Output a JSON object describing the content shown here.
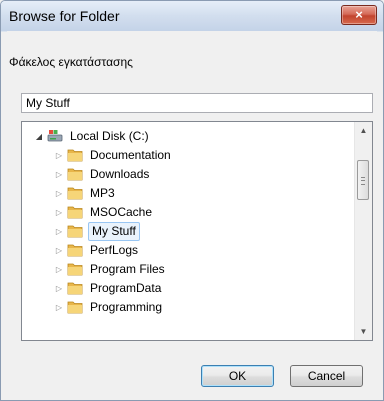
{
  "window": {
    "title": "Browse for Folder",
    "close_label": "×"
  },
  "description": "Φάκελος εγκατάστασης",
  "folder_input": {
    "value": "My Stuff"
  },
  "tree": {
    "root": {
      "label": "Local Disk (C:)",
      "expanded": true
    },
    "items": [
      {
        "label": "Documentation"
      },
      {
        "label": "Downloads"
      },
      {
        "label": "MP3"
      },
      {
        "label": "MSOCache"
      },
      {
        "label": "My Stuff",
        "selected": true
      },
      {
        "label": "PerfLogs"
      },
      {
        "label": "Program Files"
      },
      {
        "label": "ProgramData"
      },
      {
        "label": "Programming"
      }
    ]
  },
  "buttons": {
    "ok": "OK",
    "cancel": "Cancel"
  },
  "colors": {
    "titlebar": "#d2deee",
    "close_button": "#c2442e",
    "folder": "#e8b64a",
    "selection": "#eaf3fc"
  }
}
